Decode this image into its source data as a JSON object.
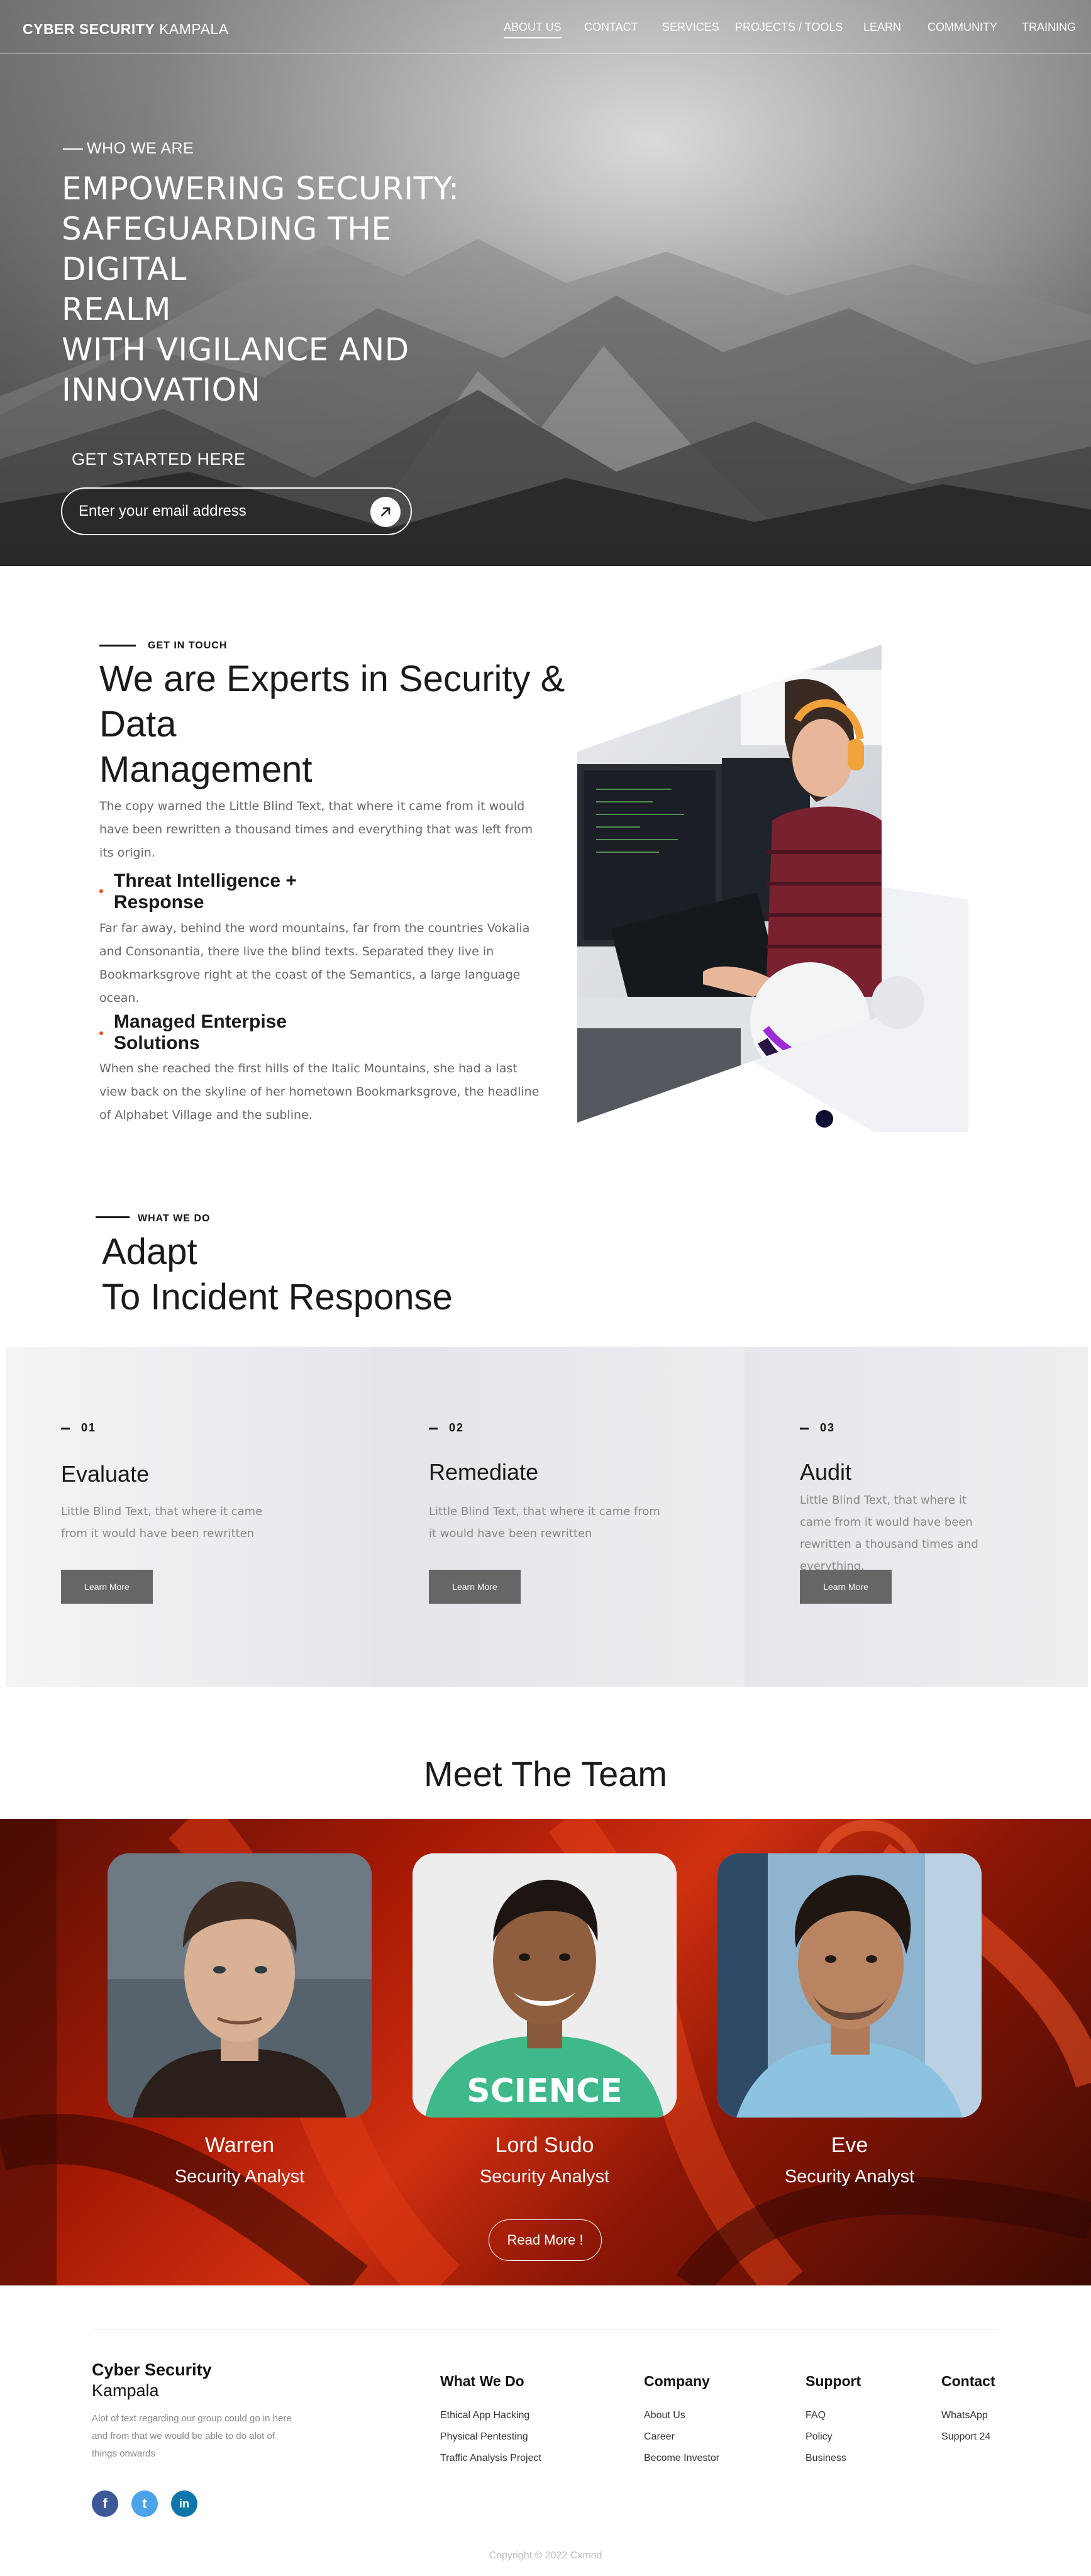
{
  "header": {
    "brand_bold": "CYBER SECURITY",
    "brand_light": "KAMPALA",
    "nav": [
      {
        "label": "ABOUT US"
      },
      {
        "label": "CONTACT"
      },
      {
        "label": "SERVICES"
      },
      {
        "label": "PROJECTS / TOOLS"
      },
      {
        "label": "LEARN"
      },
      {
        "label": "COMMUNITY"
      },
      {
        "label": "TRAINING"
      }
    ]
  },
  "hero": {
    "eyebrow": "WHO WE ARE",
    "title_lines": [
      "EMPOWERING SECURITY:",
      "SAFEGUARDING THE DIGITAL",
      "REALM",
      "WITH VIGILANCE AND",
      "INNOVATION"
    ],
    "cta_label": "GET STARTED HERE",
    "email_placeholder": "Enter your email address"
  },
  "experts": {
    "eyebrow": "GET IN TOUCH",
    "title_lines": [
      "We are Experts in Security &",
      "Data",
      "Management"
    ],
    "intro": "The copy warned the Little Blind Text, that where it came from it would have been rewritten a thousand times and everything that was left from its origin.",
    "features": [
      {
        "title_lines": [
          "Threat Intelligence +",
          "Response"
        ],
        "text": "Far far away, behind the word mountains, far from the countries Vokalia and Consonantia, there live the blind texts. Separated they live in Bookmarksgrove right at the coast of the Semantics, a large language ocean."
      },
      {
        "title_lines": [
          "Managed Enterpise",
          "Solutions"
        ],
        "text": "When she reached the first hills of the Italic Mountains, she had a last view back on the skyline of her hometown Bookmarksgrove, the headline of Alphabet Village and the subline."
      }
    ]
  },
  "what_we_do": {
    "eyebrow": "WHAT WE DO",
    "title_lines": [
      "Adapt",
      "To Incident Response"
    ],
    "cards": [
      {
        "num": "01",
        "title": "Evaluate",
        "text": "Little Blind Text, that where it came from it would have been rewritten",
        "button": "Learn More"
      },
      {
        "num": "02",
        "title": "Remediate",
        "text": "Little Blind Text, that where it came from it would have been rewritten",
        "button": "Learn More"
      },
      {
        "num": "03",
        "title": "Audit",
        "text": "Little Blind Text, that where it came from it would have been rewritten a thousand times and everything.",
        "button": "Learn More"
      }
    ]
  },
  "team": {
    "title": "Meet The Team",
    "members": [
      {
        "name": "Warren",
        "role": "Security Analyst"
      },
      {
        "name": "Lord Sudo",
        "role": "Security Analyst",
        "shirt_text": "SCIENCE"
      },
      {
        "name": "Eve",
        "role": "Security Analyst"
      }
    ],
    "read_more": "Read More !"
  },
  "footer": {
    "brand": "Cyber Security",
    "brand_sub": "Kampala",
    "text": "Alot of text regarding our group could go in here and from that we would be able to do alot of things onwards",
    "columns": [
      {
        "title": "What We Do",
        "links": [
          "Ethical App Hacking",
          "Physical Pentesting",
          "Traffic Analysis Project"
        ]
      },
      {
        "title": "Company",
        "links": [
          "About Us",
          "Career",
          "Become Investor"
        ]
      },
      {
        "title": "Support",
        "links": [
          "FAQ",
          "Policy",
          "Business"
        ]
      },
      {
        "title": "Contact",
        "links": [
          "WhatsApp",
          "Support 24"
        ]
      }
    ],
    "social": [
      {
        "icon": "facebook-icon",
        "glyph": "f",
        "color": "#3b5998"
      },
      {
        "icon": "twitter-icon",
        "glyph": "t",
        "color": "#4ba3e8"
      },
      {
        "icon": "linkedin-icon",
        "glyph": "in",
        "color": "#0e76a8"
      }
    ],
    "copyright": "Copyright © 2022 Cxmnd"
  },
  "colors": {
    "accent_dot": "#e8501e",
    "button_gray": "#666666",
    "team_band_red": "#c0240a"
  }
}
